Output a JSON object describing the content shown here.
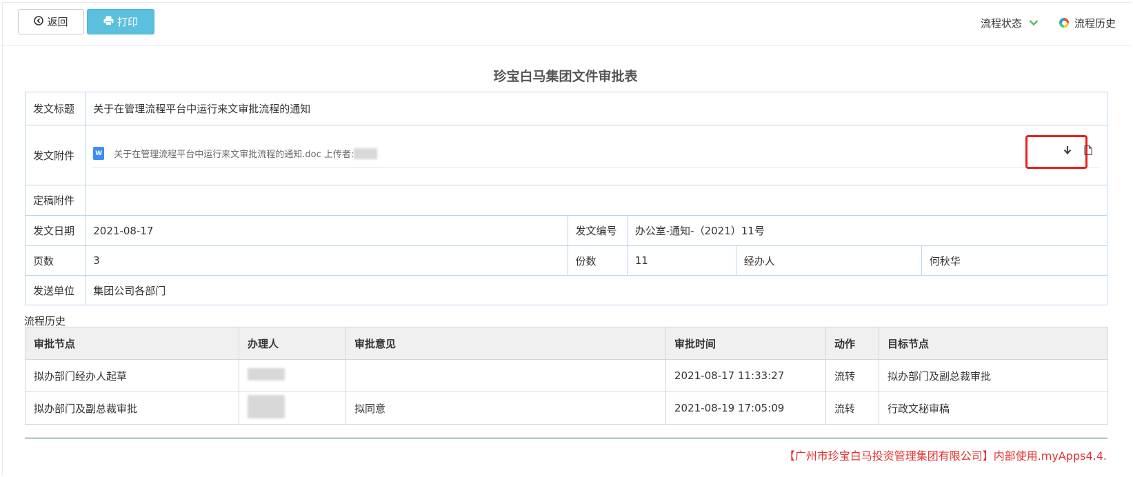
{
  "toolbar": {
    "back_label": "返回",
    "print_label": "打印",
    "status_label": "流程状态",
    "history_label": "流程历史"
  },
  "form": {
    "title": "珍宝白马集团文件审批表",
    "subject_label": "发文标题",
    "subject_value": "关于在管理流程平台中运行来文审批流程的通知",
    "attachment_label": "发文附件",
    "attachment_file": "关于在管理流程平台中运行来文审批流程的通知.doc 上传者:",
    "final_attachment_label": "定稿附件",
    "date_label": "发文日期",
    "date_value": "2021-08-17",
    "doc_no_label": "发文编号",
    "doc_no_value": "办公室-通知-（2021）11号",
    "pages_label": "页数",
    "pages_value": "3",
    "copies_label": "份数",
    "copies_value": "11",
    "handler_label": "经办人",
    "handler_value": "何秋华",
    "send_to_label": "发送单位",
    "send_to_value": "集团公司各部门"
  },
  "history": {
    "section_label": "流程历史",
    "columns": [
      "审批节点",
      "办理人",
      "审批意见",
      "审批时间",
      "动作",
      "目标节点"
    ],
    "rows": [
      [
        "拟办部门经办人起草",
        "",
        "",
        "2021-08-17 11:33:27",
        "流转",
        "拟办部门及副总裁审批"
      ],
      [
        "拟办部门及副总裁审批",
        "",
        "拟同意",
        "2021-08-19 17:05:09",
        "流转",
        "行政文秘审稿"
      ]
    ]
  },
  "footer": {
    "text": "【广州市珍宝白马投资管理集团有限公司】内部使用.myApps4.4."
  },
  "icons": {
    "back": "circle-arrow-left-icon",
    "print": "printer-icon",
    "status": "chevron-down-icon",
    "history": "color-ring-icon",
    "file": "word-doc-icon",
    "download": "download-arrow-icon",
    "preview": "document-icon"
  },
  "colors": {
    "print_button": "#5bc0de",
    "chevron": "#5cb85c",
    "highlight_box": "#ee1c1c",
    "footer_text": "#e52e2e",
    "table_border": "#bcd5ec"
  }
}
